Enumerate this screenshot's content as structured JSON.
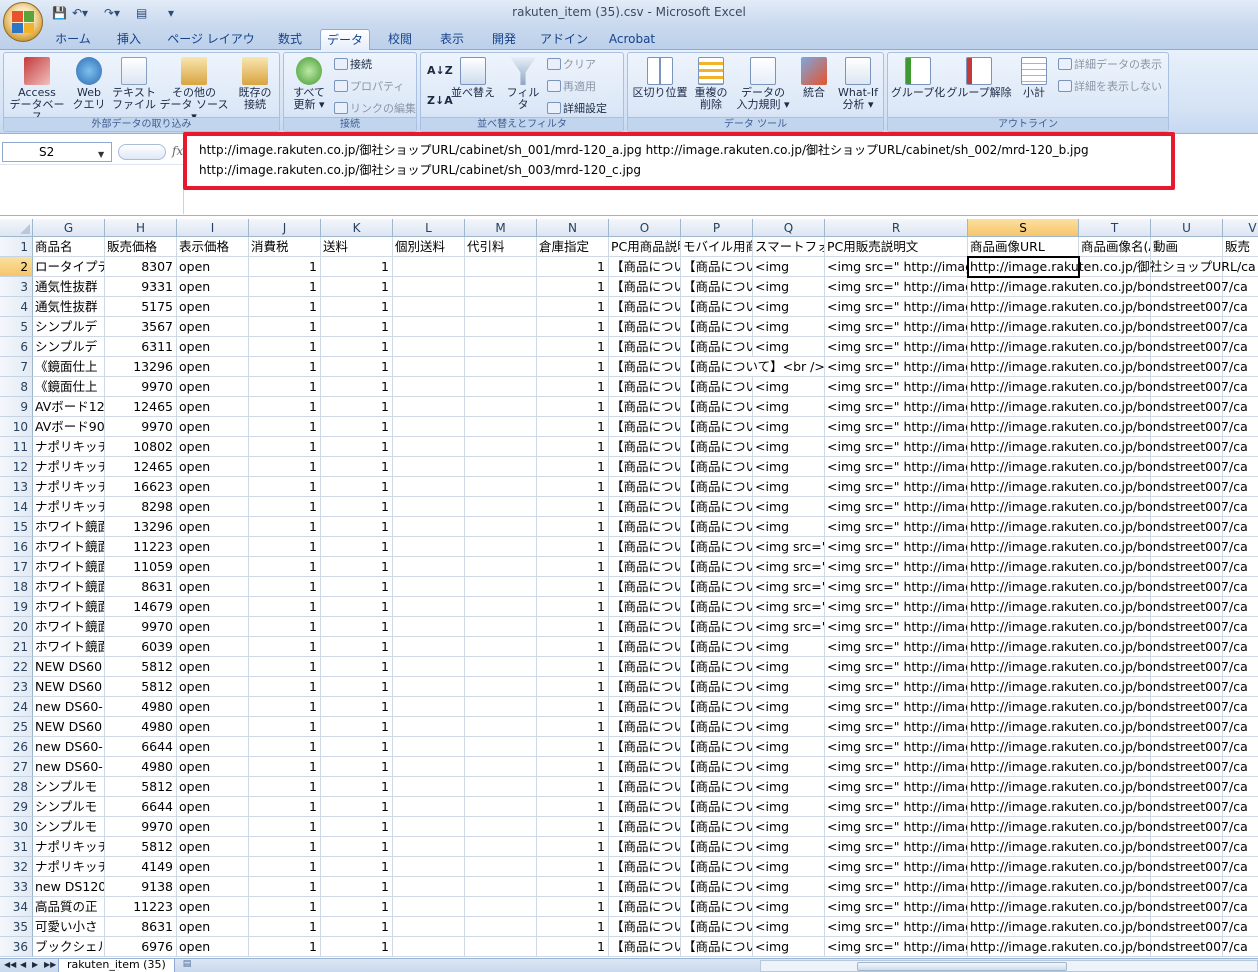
{
  "window": {
    "title": "rakuten_item (35).csv - Microsoft Excel"
  },
  "tabs": [
    "ホーム",
    "挿入",
    "ページ レイアウト",
    "数式",
    "データ",
    "校閲",
    "表示",
    "開発",
    "アドイン",
    "Acrobat"
  ],
  "active_tab": "データ",
  "ribbon": {
    "groups": [
      "外部データの取り込み",
      "接続",
      "並べ替えとフィルタ",
      "データ ツール",
      "アウトライン"
    ],
    "external": [
      {
        "l1": "Access",
        "l2": "データベース"
      },
      {
        "l1": "Web",
        "l2": "クエリ"
      },
      {
        "l1": "テキスト",
        "l2": "ファイル"
      },
      {
        "l1": "その他の",
        "l2": "データ ソース ▾"
      },
      {
        "l1": "既存の",
        "l2": "接続"
      }
    ],
    "connections": {
      "refresh": {
        "l1": "すべて",
        "l2": "更新 ▾"
      },
      "connect": "接続",
      "properties": "プロパティ",
      "edit_links": "リンクの編集"
    },
    "sort": {
      "sort": "並べ替え",
      "filter": "フィルタ",
      "clear": "クリア",
      "reapply": "再適用",
      "advanced": "詳細設定"
    },
    "tools": [
      {
        "l1": "区切り位置",
        "l2": ""
      },
      {
        "l1": "重複の",
        "l2": "削除"
      },
      {
        "l1": "データの",
        "l2": "入力規則 ▾"
      },
      {
        "l1": "統合",
        "l2": ""
      },
      {
        "l1": "What-If",
        "l2": "分析 ▾"
      }
    ],
    "outline": {
      "group": "グループ化",
      "ungroup": "グループ解除",
      "subtotal": "小計",
      "show_detail": "詳細データの表示",
      "hide_detail": "詳細を表示しない"
    }
  },
  "name_box": "S2",
  "fx_label": "fx",
  "formula_bar": "http://image.rakuten.co.jp/御社ショップURL/cabinet/sh_001/mrd-120_a.jpg http://image.rakuten.co.jp/御社ショップURL/cabinet/sh_002/mrd-120_b.jpg\nhttp://image.rakuten.co.jp/御社ショップURL/cabinet/sh_003/mrd-120_c.jpg",
  "columns": [
    "G",
    "H",
    "I",
    "J",
    "K",
    "L",
    "M",
    "N",
    "O",
    "P",
    "Q",
    "R",
    "S",
    "T",
    "U",
    "V"
  ],
  "selected_column": "S",
  "selected_row": "2",
  "header_row": [
    "商品名",
    "販売価格",
    "表示価格",
    "消費税",
    "送料",
    "個別送料",
    "代引料",
    "倉庫指定",
    "PC用商品説明文",
    "モバイル用商品説明文",
    "スマートフォン用商品説明文",
    "PC用販売説明文",
    "商品画像URL",
    "商品画像名(ALT)",
    "動画",
    "販売"
  ],
  "rows": [
    {
      "n": "2",
      "name": "ロータイプテ",
      "price": "8307",
      "o": "【商品につい",
      "p": "【商品につい",
      "q": "<img",
      "r": "<img src=\" http://imag",
      "s": "http://image.rakuten.co.jp/御社ショップURL/ca"
    },
    {
      "n": "3",
      "name": "通気性抜群",
      "price": "9331",
      "o": "【商品につい",
      "p": "【商品につい",
      "q": "<img",
      "r": "<img src=\" http://imag",
      "s": "http://image.rakuten.co.jp/bondstreet007/ca"
    },
    {
      "n": "4",
      "name": "通気性抜群",
      "price": "5175",
      "o": "【商品につい",
      "p": "【商品につい",
      "q": "<img",
      "r": "<img src=\" http://imag",
      "s": "http://image.rakuten.co.jp/bondstreet007/ca"
    },
    {
      "n": "5",
      "name": "シンプルデ",
      "price": "3567",
      "o": "【商品につい",
      "p": "【商品につい",
      "q": "<img",
      "r": "<img src=\" http://imag",
      "s": "http://image.rakuten.co.jp/bondstreet007/ca"
    },
    {
      "n": "6",
      "name": "シンプルデ",
      "price": "6311",
      "o": "【商品につい",
      "p": "【商品につい",
      "q": "<img",
      "r": "<img src=\" http://imag",
      "s": "http://image.rakuten.co.jp/bondstreet007/ca"
    },
    {
      "n": "7",
      "name": "《鏡面仕上",
      "price": "13296",
      "o": "【商品につい",
      "p": "【商品について】<br />",
      "q": "",
      "r": "<img src=\" http://imag",
      "s": "http://image.rakuten.co.jp/bondstreet007/ca"
    },
    {
      "n": "8",
      "name": "《鏡面仕上",
      "price": "9970",
      "o": "【商品につい",
      "p": "【商品につい",
      "q": "<img",
      "r": "<img src=\" http://imag",
      "s": "http://image.rakuten.co.jp/bondstreet007/ca"
    },
    {
      "n": "9",
      "name": "AVボード12",
      "price": "12465",
      "o": "【商品につい",
      "p": "【商品につい",
      "q": "<img",
      "r": "<img src=\" http://imag",
      "s": "http://image.rakuten.co.jp/bondstreet007/ca"
    },
    {
      "n": "10",
      "name": "AVボード90",
      "price": "9970",
      "o": "【商品につい",
      "p": "【商品につい",
      "q": "<img",
      "r": "<img src=\" http://imag",
      "s": "http://image.rakuten.co.jp/bondstreet007/ca"
    },
    {
      "n": "11",
      "name": "ナポリキッチ",
      "price": "10802",
      "o": "【商品につい",
      "p": "【商品につい",
      "q": "<img",
      "r": "<img src=\" http://imag",
      "s": "http://image.rakuten.co.jp/bondstreet007/ca"
    },
    {
      "n": "12",
      "name": "ナポリキッチ",
      "price": "12465",
      "o": "【商品につい",
      "p": "【商品につい",
      "q": "<img",
      "r": "<img src=\" http://imag",
      "s": "http://image.rakuten.co.jp/bondstreet007/ca"
    },
    {
      "n": "13",
      "name": "ナポリキッチ",
      "price": "16623",
      "o": "【商品につい",
      "p": "【商品につい",
      "q": "<img",
      "r": "<img src=\" http://imag",
      "s": "http://image.rakuten.co.jp/bondstreet007/ca"
    },
    {
      "n": "14",
      "name": "ナポリキッチ",
      "price": "8298",
      "o": "【商品につい",
      "p": "【商品につい",
      "q": "<img",
      "r": "<img src=\" http://imag",
      "s": "http://image.rakuten.co.jp/bondstreet007/ca"
    },
    {
      "n": "15",
      "name": "ホワイト鏡面",
      "price": "13296",
      "o": "【商品につい",
      "p": "【商品につい",
      "q": "<img",
      "r": "<img src=\" http://imag",
      "s": "http://image.rakuten.co.jp/bondstreet007/ca"
    },
    {
      "n": "16",
      "name": "ホワイト鏡面",
      "price": "11223",
      "o": "【商品につい",
      "p": "【商品につい",
      "q": "<img src=\"",
      "r": "<img src=\" http://imag",
      "s": "http://image.rakuten.co.jp/bondstreet007/ca"
    },
    {
      "n": "17",
      "name": "ホワイト鏡面",
      "price": "11059",
      "o": "【商品につい",
      "p": "【商品につい",
      "q": "<img src=\"",
      "r": "<img src=\" http://imag",
      "s": "http://image.rakuten.co.jp/bondstreet007/ca"
    },
    {
      "n": "18",
      "name": "ホワイト鏡面",
      "price": "8631",
      "o": "【商品につい",
      "p": "【商品につい",
      "q": "<img src=\"",
      "r": "<img src=\" http://imag",
      "s": "http://image.rakuten.co.jp/bondstreet007/ca"
    },
    {
      "n": "19",
      "name": "ホワイト鏡面",
      "price": "14679",
      "o": "【商品につい",
      "p": "【商品につい",
      "q": "<img src=\"",
      "r": "<img src=\" http://imag",
      "s": "http://image.rakuten.co.jp/bondstreet007/ca"
    },
    {
      "n": "20",
      "name": "ホワイト鏡面",
      "price": "9970",
      "o": "【商品につい",
      "p": "【商品につい",
      "q": "<img src=\"",
      "r": "<img src=\" http://imag",
      "s": "http://image.rakuten.co.jp/bondstreet007/ca"
    },
    {
      "n": "21",
      "name": "ホワイト鏡面",
      "price": "6039",
      "o": "【商品につい",
      "p": "【商品につい",
      "q": "<img",
      "r": "<img src=\" http://imag",
      "s": "http://image.rakuten.co.jp/bondstreet007/ca"
    },
    {
      "n": "22",
      "name": "NEW DS60",
      "price": "5812",
      "o": "【商品につい",
      "p": "【商品につい",
      "q": "<img",
      "r": "<img src=\" http://imag",
      "s": "http://image.rakuten.co.jp/bondstreet007/ca"
    },
    {
      "n": "23",
      "name": "NEW DS60",
      "price": "5812",
      "o": "【商品につい",
      "p": "【商品につい",
      "q": "<img",
      "r": "<img src=\" http://imag",
      "s": "http://image.rakuten.co.jp/bondstreet007/ca"
    },
    {
      "n": "24",
      "name": "new DS60-",
      "price": "4980",
      "o": "【商品につい",
      "p": "【商品につい",
      "q": "<img",
      "r": "<img src=\" http://imag",
      "s": "http://image.rakuten.co.jp/bondstreet007/ca"
    },
    {
      "n": "25",
      "name": "NEW DS60",
      "price": "4980",
      "o": "【商品につい",
      "p": "【商品につい",
      "q": "<img",
      "r": "<img src=\" http://imag",
      "s": "http://image.rakuten.co.jp/bondstreet007/ca"
    },
    {
      "n": "26",
      "name": "new DS60-",
      "price": "6644",
      "o": "【商品につい",
      "p": "【商品につい",
      "q": "<img",
      "r": "<img src=\" http://imag",
      "s": "http://image.rakuten.co.jp/bondstreet007/ca"
    },
    {
      "n": "27",
      "name": "new DS60-",
      "price": "4980",
      "o": "【商品につい",
      "p": "【商品につい",
      "q": "<img",
      "r": "<img src=\" http://imag",
      "s": "http://image.rakuten.co.jp/bondstreet007/ca"
    },
    {
      "n": "28",
      "name": "シンプルモ",
      "price": "5812",
      "o": "【商品につい",
      "p": "【商品につい",
      "q": "<img",
      "r": "<img src=\" http://imag",
      "s": "http://image.rakuten.co.jp/bondstreet007/ca"
    },
    {
      "n": "29",
      "name": "シンプルモ",
      "price": "6644",
      "o": "【商品につい",
      "p": "【商品につい",
      "q": "<img",
      "r": "<img src=\" http://imag",
      "s": "http://image.rakuten.co.jp/bondstreet007/ca"
    },
    {
      "n": "30",
      "name": "シンプルモ",
      "price": "9970",
      "o": "【商品につい",
      "p": "【商品につい",
      "q": "<img",
      "r": "<img src=\" http://imag",
      "s": "http://image.rakuten.co.jp/bondstreet007/ca"
    },
    {
      "n": "31",
      "name": "ナポリキッチ",
      "price": "5812",
      "o": "【商品につい",
      "p": "【商品につい",
      "q": "<img",
      "r": "<img src=\" http://imag",
      "s": "http://image.rakuten.co.jp/bondstreet007/ca"
    },
    {
      "n": "32",
      "name": "ナポリキッチ",
      "price": "4149",
      "o": "【商品につい",
      "p": "【商品につい",
      "q": "<img",
      "r": "<img src=\" http://imag",
      "s": "http://image.rakuten.co.jp/bondstreet007/ca"
    },
    {
      "n": "33",
      "name": "new DS120",
      "price": "9138",
      "o": "【商品につい",
      "p": "【商品につい",
      "q": "<img",
      "r": "<img src=\" http://imag",
      "s": "http://image.rakuten.co.jp/bondstreet007/ca"
    },
    {
      "n": "34",
      "name": "高品質の正",
      "price": "11223",
      "o": "【商品につい",
      "p": "【商品につい",
      "q": "<img",
      "r": "<img src=\" http://imag",
      "s": "http://image.rakuten.co.jp/bondstreet007/ca"
    },
    {
      "n": "35",
      "name": "可愛い小さ",
      "price": "8631",
      "o": "【商品につい",
      "p": "【商品につい",
      "q": "<img",
      "r": "<img src=\" http://imag",
      "s": "http://image.rakuten.co.jp/bondstreet007/ca"
    },
    {
      "n": "36",
      "name": "ブックシェル",
      "price": "6976",
      "o": "【商品につい",
      "p": "【商品につい",
      "q": "<img",
      "r": "<img src=\" http://imag",
      "s": "http://image.rakuten.co.jp/bondstreet007/ca"
    }
  ],
  "constants": {
    "display_price": "open",
    "tax": "1",
    "shipping": "1",
    "warehouse": "1"
  },
  "sheet_tab": "rakuten_item (35)",
  "colors": {
    "highlight_border": "#e8192c",
    "selected_header": "#f6c56a",
    "accent": "#15428b"
  }
}
